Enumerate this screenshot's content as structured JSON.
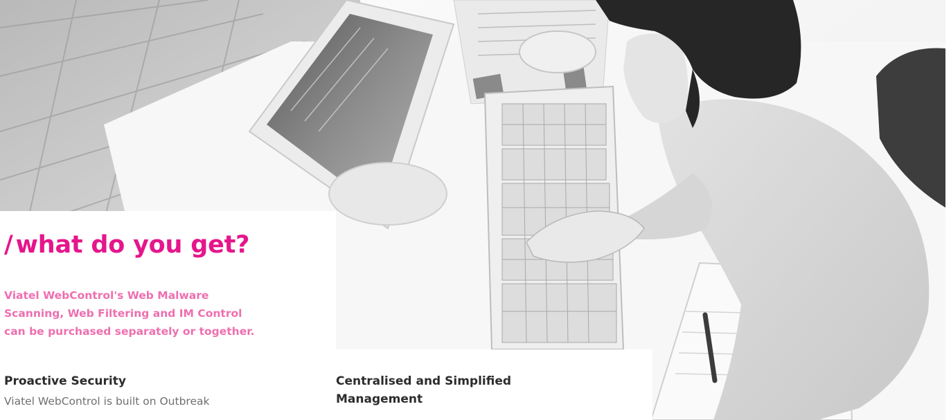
{
  "hero": {
    "headline_slash": "/",
    "headline": "what do you get?",
    "intro_lines": [
      "Viatel WebControl's Web Malware",
      "Scanning, Web Filtering and IM Control",
      "can be purchased separately or together."
    ]
  },
  "features": [
    {
      "title": "Proactive Security",
      "body": "Viatel WebControl is built on Outbreak"
    },
    {
      "title_lines": [
        "Centralised and Simplified",
        "Management"
      ]
    }
  ],
  "colors": {
    "accent_pink": "#e5168b",
    "intro_pink": "#ee6fb0",
    "heading_dark": "#2c2c2c",
    "body_gray": "#6f6f6f"
  }
}
